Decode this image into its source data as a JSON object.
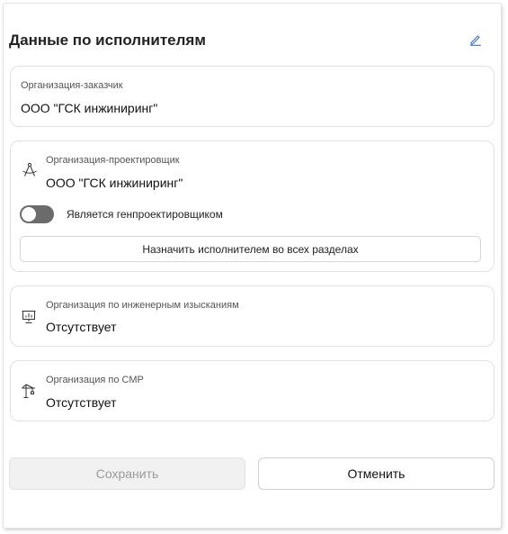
{
  "header": {
    "title": "Данные по исполнителям",
    "edit_icon": "pencil-icon",
    "accent_color": "#3a6fd8"
  },
  "customer": {
    "label": "Организация-заказчик",
    "value": "ООО \"ГСК инжиниринг\""
  },
  "designer": {
    "icon": "compass-icon",
    "label": "Организация-проектировщик",
    "value": "ООО \"ГСК инжиниринг\"",
    "toggle_label": "Является генпроектировщиком",
    "toggle_on": false,
    "assign_button": "Назначить исполнителем во всех разделах"
  },
  "surveys": {
    "icon": "presentation-chart-icon",
    "label": "Организация по инженерным изысканиям",
    "value": "Отсутствует"
  },
  "construction": {
    "icon": "crane-icon",
    "label": "Организация по СМР",
    "value": "Отсутствует"
  },
  "footer": {
    "save_label": "Сохранить",
    "cancel_label": "Отменить"
  }
}
